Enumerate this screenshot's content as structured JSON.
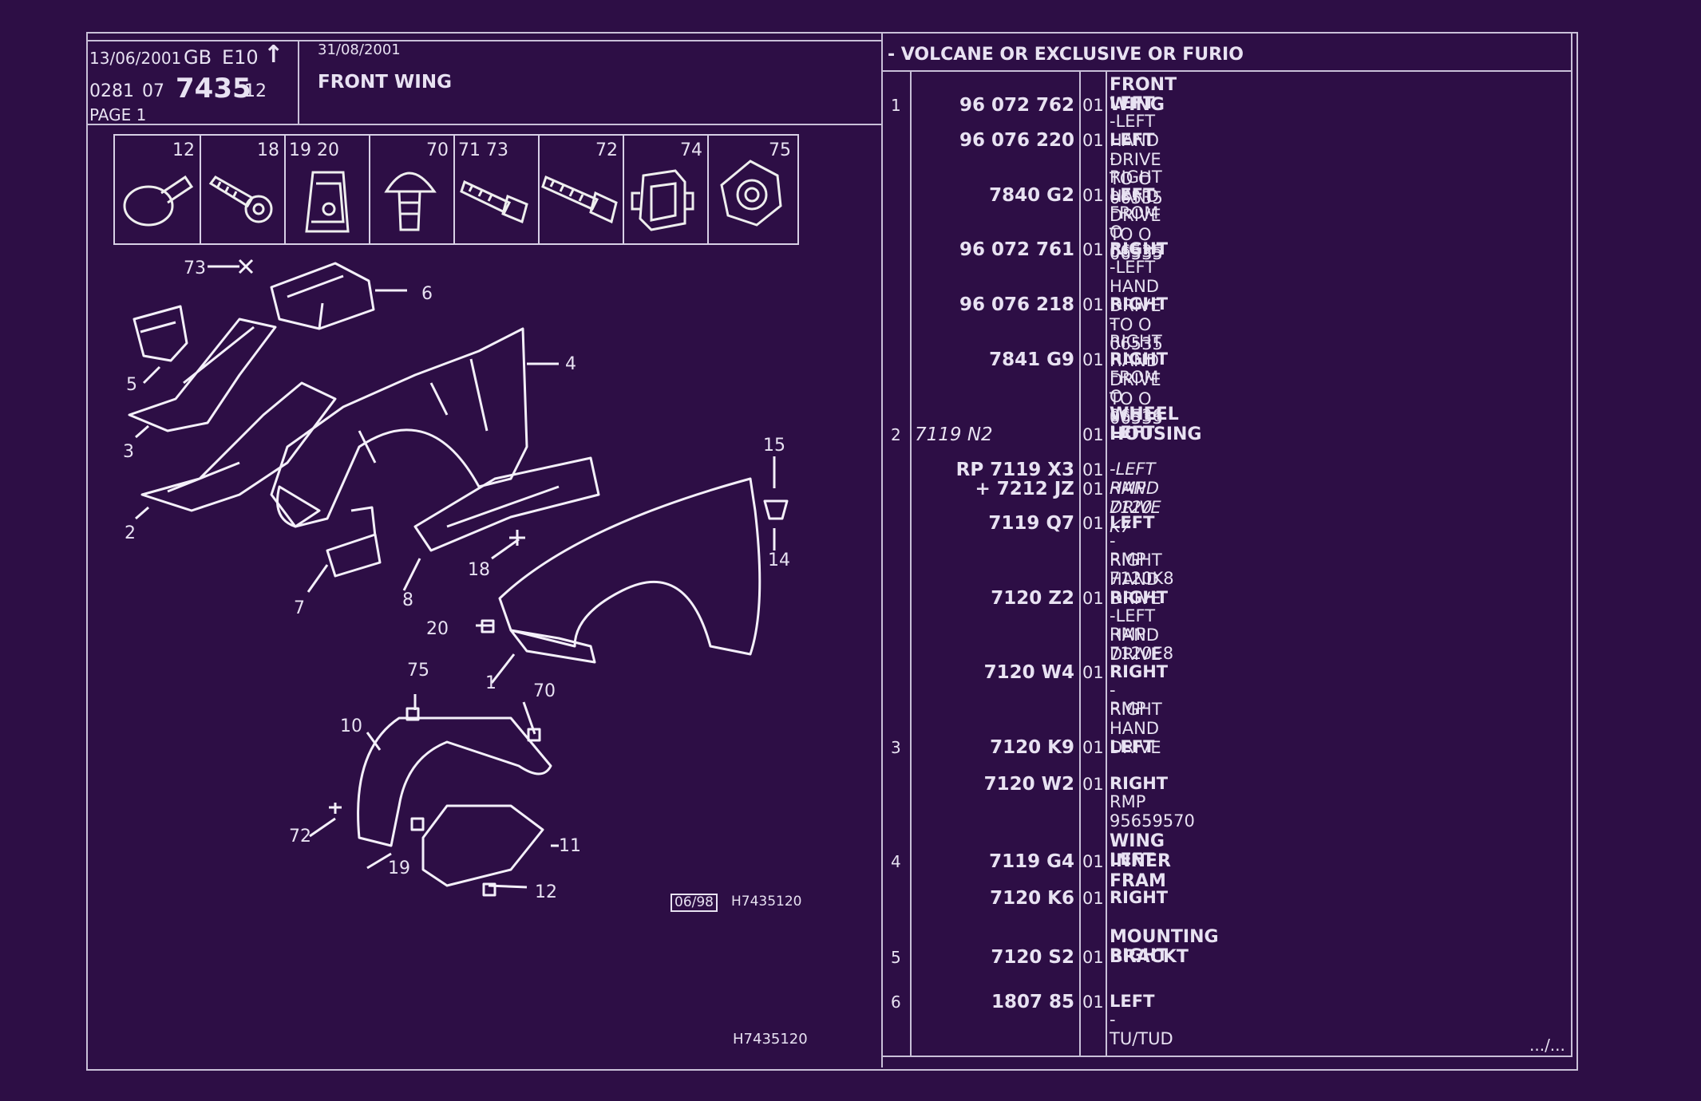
{
  "header": {
    "date_print": "13/06/2001",
    "lang": "GB",
    "edition": "E10",
    "arrow": "↑",
    "ref_a": "0281",
    "ref_b": "07",
    "plate": "7435",
    "ref_c": "12",
    "page": "PAGE 1",
    "date_issue": "31/08/2001",
    "title": "FRONT WING",
    "range": "- VOLCANE OR  EXCLUSIVE OR  FURIO"
  },
  "fasteners": [
    {
      "label": "12",
      "icon": "push-clip-icon"
    },
    {
      "label": "18",
      "icon": "screw-icon"
    },
    {
      "label": "19   20",
      "icon": "clip-nut-icon"
    },
    {
      "label": "70",
      "icon": "rivet-icon"
    },
    {
      "label": "71   73",
      "icon": "bolt-icon"
    },
    {
      "label": "72",
      "icon": "long-bolt-icon"
    },
    {
      "label": "74",
      "icon": "cage-nut-icon"
    },
    {
      "label": "75",
      "icon": "hex-nut-icon"
    }
  ],
  "diagram": {
    "callouts": [
      "73",
      "6",
      "5",
      "4",
      "3",
      "2",
      "15",
      "14",
      "7",
      "8",
      "18",
      "20",
      "1",
      "75",
      "70",
      "10",
      "72",
      "19",
      "11",
      "12"
    ],
    "stamp": "06/98",
    "code": "H7435120",
    "footer_code": "H7435120"
  },
  "parts": [
    {
      "ref": "1",
      "code": "96 072 762",
      "qty": "01",
      "lines": [
        {
          "t": "FRONT WING",
          "style": "heading"
        },
        {
          "t": "LEFT",
          "style": "bold"
        },
        {
          "t": "-LEFT HAND DRIVE TO  O  06535",
          "style": "normal"
        }
      ]
    },
    {
      "ref": "",
      "code": "96 076 220",
      "qty": "01",
      "lines": [
        {
          "t": "LEFT",
          "style": "bold"
        },
        {
          "t": "-RIGHT HAND DRIVE TO  O  06535",
          "style": "normal"
        }
      ]
    },
    {
      "ref": "",
      "code": "7840 G2",
      "qty": "01",
      "lines": [
        {
          "t": "LEFT",
          "style": "bold"
        },
        {
          "t": "FROM  O  06535",
          "style": "normal"
        }
      ]
    },
    {
      "ref": "",
      "code": "96 072 761",
      "qty": "01",
      "lines": [
        {
          "t": "RIGHT",
          "style": "bold"
        },
        {
          "t": "-LEFT HAND DRIVE TO  O  06535",
          "style": "normal"
        }
      ]
    },
    {
      "ref": "",
      "code": "96 076 218",
      "qty": "01",
      "lines": [
        {
          "t": "RIGHT",
          "style": "bold"
        },
        {
          "t": "-RIGHT HAND DRIVE TO  O  06535",
          "style": "normal"
        }
      ]
    },
    {
      "ref": "",
      "code": "7841 G9",
      "qty": "01",
      "lines": [
        {
          "t": "RIGHT",
          "style": "bold"
        },
        {
          "t": "FROM  O  06536",
          "style": "normal"
        }
      ]
    },
    {
      "ref": "2",
      "code": "7119 N2",
      "qty": "01",
      "lines": [
        {
          "t": "WHEEL HOUSING",
          "style": "heading"
        },
        {
          "t": "LEFT",
          "style": "bold"
        }
      ]
    },
    {
      "ref": "",
      "code": "RP  7119 X3",
      "qty": "01",
      "lines": [
        {
          "t": "-LEFT HAND DRIVE",
          "style": "italic"
        }
      ]
    },
    {
      "ref": "",
      "code": "+  7212 JZ",
      "qty": "01",
      "lines": [
        {
          "t": "RMP 7120 K7",
          "style": "italic"
        }
      ]
    },
    {
      "ref": "",
      "code": "7119 Q7",
      "qty": "01",
      "lines": [
        {
          "t": "LEFT",
          "style": "bold"
        },
        {
          "t": "-RIGHT HAND DRIVE",
          "style": "normal"
        },
        {
          "t": "RMP 7120K8",
          "style": "normal"
        }
      ]
    },
    {
      "ref": "",
      "code": "7120 Z2",
      "qty": "01",
      "lines": [
        {
          "t": "RIGHT",
          "style": "bold"
        },
        {
          "t": "-LEFT HAND DRIVE",
          "style": "normal"
        },
        {
          "t": "RMP 7120E8",
          "style": "normal"
        }
      ]
    },
    {
      "ref": "",
      "code": "7120 W4",
      "qty": "01",
      "lines": [
        {
          "t": "RIGHT",
          "style": "bold"
        },
        {
          "t": "-RIGHT HAND DRIVE",
          "style": "normal"
        },
        {
          "t": "RMP",
          "style": "normal"
        }
      ]
    },
    {
      "ref": "3",
      "code": "7120 K9",
      "qty": "01",
      "lines": [
        {
          "t": "LEFT",
          "style": "bold"
        }
      ]
    },
    {
      "ref": "",
      "code": "7120 W2",
      "qty": "01",
      "lines": [
        {
          "t": "RIGHT",
          "style": "bold"
        },
        {
          "t": "RMP 95659570",
          "style": "normal"
        }
      ]
    },
    {
      "ref": "4",
      "code": "7119 G4",
      "qty": "01",
      "lines": [
        {
          "t": "WING INNER FRAM",
          "style": "heading"
        },
        {
          "t": "LEFT",
          "style": "bold"
        }
      ]
    },
    {
      "ref": "",
      "code": "7120 K6",
      "qty": "01",
      "lines": [
        {
          "t": "RIGHT",
          "style": "bold"
        }
      ]
    },
    {
      "ref": "5",
      "code": "7120 S2",
      "qty": "01",
      "lines": [
        {
          "t": "MOUNTING BRACKT",
          "style": "heading"
        },
        {
          "t": "RIGHT",
          "style": "bold"
        }
      ]
    },
    {
      "ref": "6",
      "code": "1807 85",
      "qty": "01",
      "lines": [
        {
          "t": "LEFT",
          "style": "bold"
        },
        {
          "t": "-TU/TUD",
          "style": "normal"
        }
      ]
    }
  ],
  "continuation": ".../..."
}
